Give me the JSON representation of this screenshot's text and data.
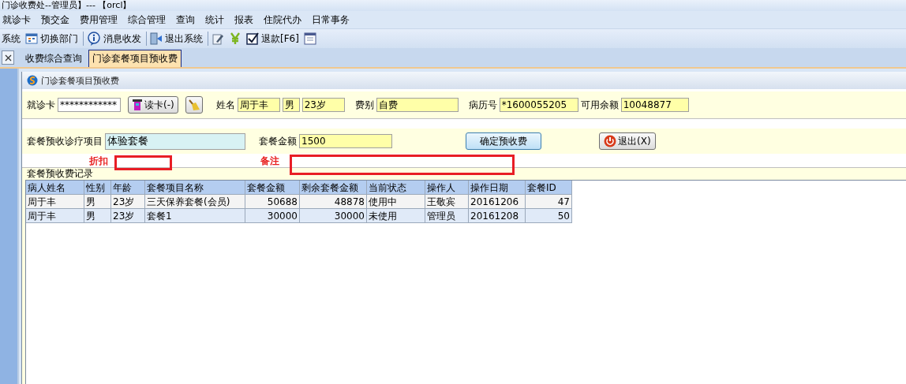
{
  "window": {
    "title": "门诊收费处--管理员】--- 【orcl】"
  },
  "menu": [
    "就诊卡",
    "预交金",
    "费用管理",
    "综合管理",
    "查询",
    "统计",
    "报表",
    "住院代办",
    "日常事务"
  ],
  "toolbar": [
    [
      {
        "kind": "button",
        "label": "系统"
      },
      {
        "kind": "button",
        "label": "切换部门"
      }
    ],
    [
      {
        "kind": "button",
        "label": "消息收发"
      }
    ],
    [
      {
        "kind": "button",
        "label": "退出系统"
      }
    ],
    [
      {
        "kind": "icon"
      },
      {
        "kind": "icon"
      },
      {
        "kind": "button",
        "label": "退款[F6]"
      },
      {
        "kind": "icon"
      }
    ]
  ],
  "tabs": [
    {
      "label": "收费综合查询",
      "selected": false
    },
    {
      "label": "门诊套餐项目预收费",
      "selected": true
    }
  ],
  "panel": {
    "title": "门诊套餐项目预收费"
  },
  "patient": {
    "card_label": "就诊卡",
    "card_value": "************",
    "read_button": "读卡(-)",
    "name_label": "姓名",
    "name": "周于丰",
    "sex": "男",
    "age": "23岁",
    "type_label": "费别",
    "type": "自费",
    "record_label": "病历号",
    "record": "*1600055205",
    "balance_label": "可用余额",
    "balance": "10048877"
  },
  "package": {
    "item_label": "套餐预收诊疗项目",
    "item": "体验套餐",
    "amount_label": "套餐金额",
    "amount": "1500",
    "confirm_button": "确定预收费",
    "exit_button": "退出(X)"
  },
  "annotations": [
    {
      "label": "折扣"
    },
    {
      "label": "备注"
    }
  ],
  "records": {
    "title": "套餐预收费记录",
    "columns": [
      {
        "label": "病人姓名",
        "numeric": false
      },
      {
        "label": "性别",
        "numeric": false
      },
      {
        "label": "年龄",
        "numeric": false
      },
      {
        "label": "套餐项目名称",
        "numeric": false
      },
      {
        "label": "套餐金额",
        "numeric": true
      },
      {
        "label": "剩余套餐金额",
        "numeric": true
      },
      {
        "label": "当前状态",
        "numeric": false
      },
      {
        "label": "操作人",
        "numeric": false
      },
      {
        "label": "操作日期",
        "numeric": false
      },
      {
        "label": "套餐ID",
        "numeric": true
      }
    ],
    "rows": [
      [
        "周于丰",
        "男",
        "23岁",
        "三天保养套餐(会员)",
        "50688",
        "48878",
        "使用中",
        "王敬宾",
        "20161206",
        "47"
      ],
      [
        "周于丰",
        "男",
        "23岁",
        "套餐1",
        "30000",
        "30000",
        "未使用",
        "管理员",
        "20161208",
        "50"
      ]
    ]
  }
}
